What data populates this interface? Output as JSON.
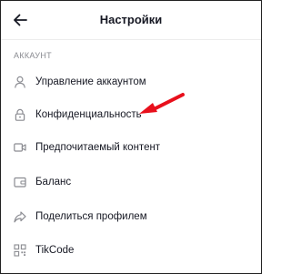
{
  "header": {
    "title": "Настройки"
  },
  "section": {
    "title": "АККАУНТ"
  },
  "items": [
    {
      "label": "Управление аккаунтом",
      "icon": "person-icon"
    },
    {
      "label": "Конфиденциальность",
      "icon": "lock-icon"
    },
    {
      "label": "Предпочитаемый контент",
      "icon": "video-camera-icon"
    },
    {
      "label": "Баланс",
      "icon": "wallet-icon"
    },
    {
      "label": "Поделиться профилем",
      "icon": "share-icon"
    },
    {
      "label": "TikCode",
      "icon": "qr-code-icon"
    }
  ],
  "colors": {
    "text": "#161823",
    "muted": "#8a8b91",
    "arrow": "#e8101c"
  }
}
